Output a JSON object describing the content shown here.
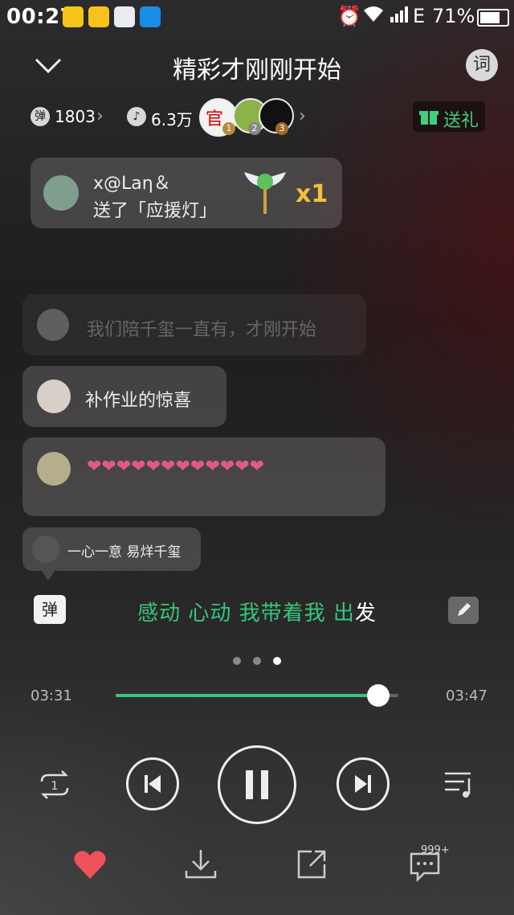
{
  "status_bar": {
    "time": "00:27",
    "network": "E",
    "battery": "71%",
    "app_icons": [
      "qq-music-icon",
      "game-icon",
      "baidu-icon",
      "screenshot-icon"
    ]
  },
  "header": {
    "title": "精彩才刚刚开始",
    "lyrics_button": "词"
  },
  "stats": {
    "danmaku_badge": "弹",
    "danmaku_count": "1803",
    "listeners_count": "6.3万",
    "top_fans": [
      {
        "rank": "1"
      },
      {
        "rank": "2"
      },
      {
        "rank": "3"
      }
    ],
    "gift_button": "送礼"
  },
  "gift_notice": {
    "user": "x@Laη＆",
    "text": "送了「应援灯」",
    "count": "x1"
  },
  "comments": [
    {
      "text": "我们陪千玺一直有，才刚开始"
    },
    {
      "text": "补作业的惊喜"
    },
    {
      "text": "❤❤❤❤❤❤❤❤❤❤❤❤"
    },
    {
      "text": "一心一意 易烊千玺"
    }
  ],
  "lyric": {
    "danmaku_button": "弹",
    "sung": "感动 心动 我带着我 出",
    "unsung": "发"
  },
  "player": {
    "elapsed": "03:31",
    "duration": "03:47",
    "progress": 0.93,
    "page_dots": 3,
    "active_dot": 2,
    "comments_badge": "999+"
  },
  "colors": {
    "accent": "#34c77b",
    "heart": "#f0525a"
  }
}
